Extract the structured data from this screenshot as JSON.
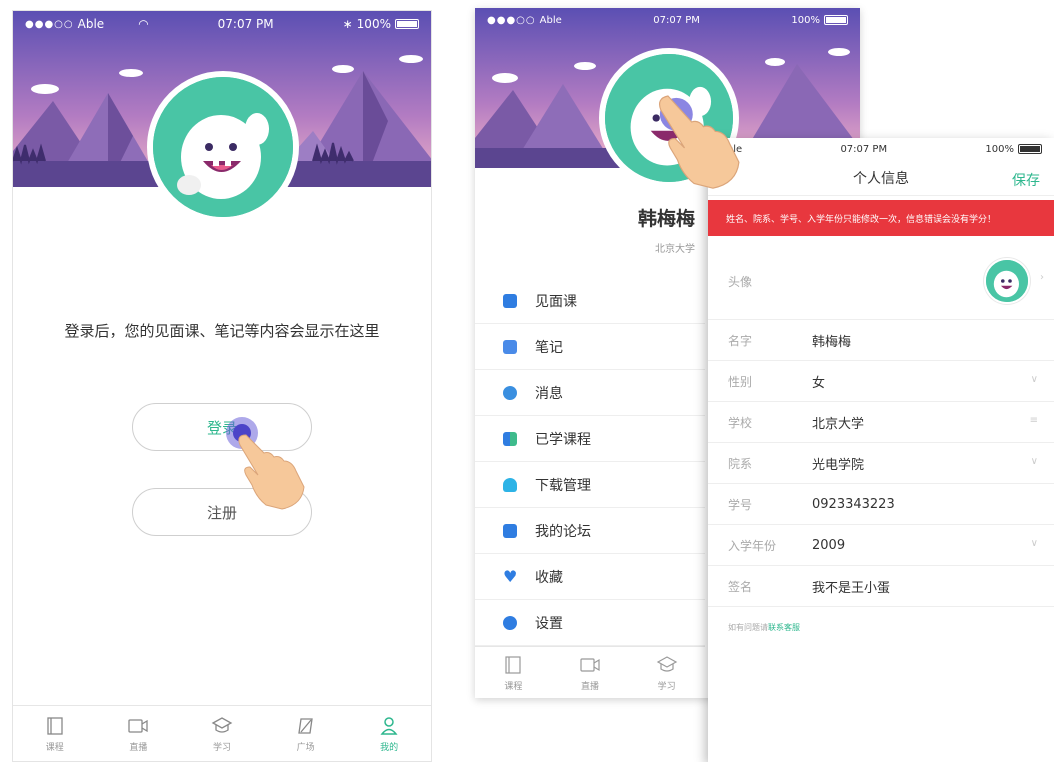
{
  "status_bar": {
    "carrier": "Able",
    "time": "07:07 PM",
    "battery": "100%"
  },
  "login_screen": {
    "prompt": "登录后，您的见面课、笔记等内容会显示在这里",
    "login_label": "登录",
    "register_label": "注册"
  },
  "tabbar": {
    "items": [
      {
        "label": "课程",
        "icon": "course-icon"
      },
      {
        "label": "直播",
        "icon": "live-icon"
      },
      {
        "label": "学习",
        "icon": "study-icon"
      },
      {
        "label": "广场",
        "icon": "plaza-icon"
      },
      {
        "label": "我的",
        "icon": "me-icon",
        "active": true
      }
    ]
  },
  "profile_screen": {
    "username": "韩梅梅",
    "school": "北京大学",
    "menu": [
      {
        "label": "见面课",
        "color": "#2f7de1"
      },
      {
        "label": "笔记",
        "color": "#4a8be8"
      },
      {
        "label": "消息",
        "color": "#3a8fe0"
      },
      {
        "label": "已学课程",
        "color": "#3ebb8c"
      },
      {
        "label": "下载管理",
        "color": "#2db3e6"
      },
      {
        "label": "我的论坛",
        "color": "#2f7de1"
      },
      {
        "label": "收藏",
        "color": "#2f7de1"
      },
      {
        "label": "设置",
        "color": "#2f7de1"
      }
    ],
    "tabbar_labels": [
      "课程",
      "直播",
      "学习"
    ]
  },
  "info_screen": {
    "title": "个人信息",
    "save_label": "保存",
    "warning": "姓名、院系、学号、入学年份只能修改一次，信息错误会没有学分！",
    "avatar_label": "头像",
    "rows": [
      {
        "label": "名字",
        "value": "韩梅梅"
      },
      {
        "label": "性别",
        "value": "女",
        "tail": "∨"
      },
      {
        "label": "学校",
        "value": "北京大学",
        "tail": "≡"
      },
      {
        "label": "院系",
        "value": "光电学院",
        "tail": "∨"
      },
      {
        "label": "学号",
        "value": "0923343223"
      },
      {
        "label": "入学年份",
        "value": "2009",
        "tail": "∨"
      },
      {
        "label": "签名",
        "value": "我不是王小蛋"
      }
    ],
    "footnote_prefix": "如有问题请",
    "footnote_link": "联系客服"
  },
  "colors": {
    "accent": "#2eb78e",
    "warning": "#e8373e",
    "mascot_bg": "#49c5a5"
  }
}
